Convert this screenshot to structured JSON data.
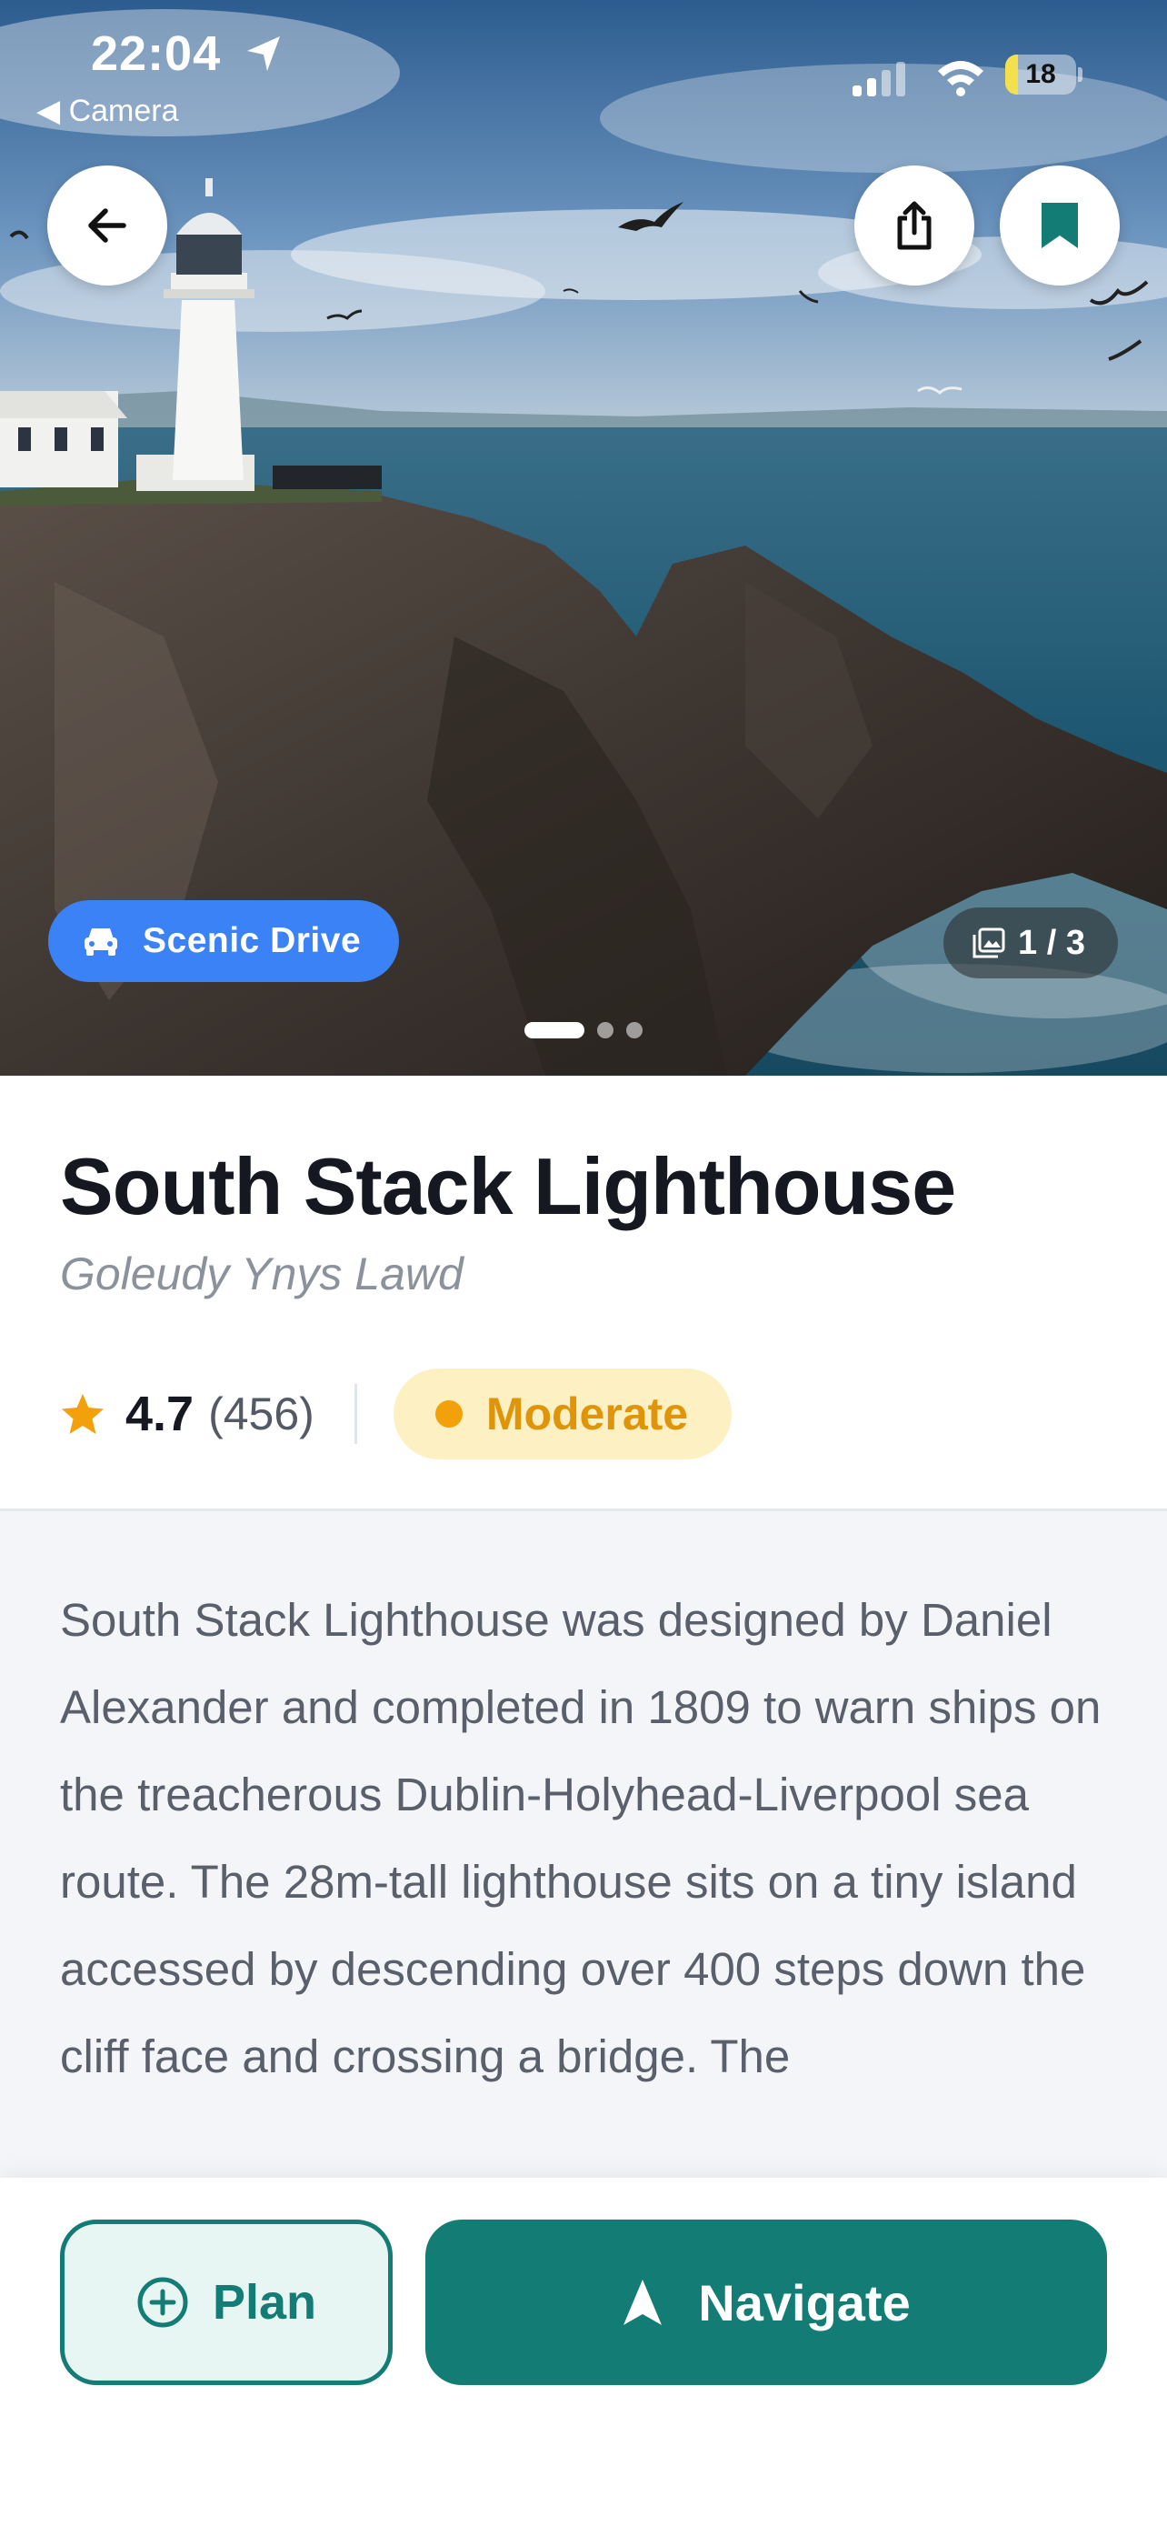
{
  "status_bar": {
    "time": "22:04",
    "back_app": "◀ Camera",
    "battery_level": "18"
  },
  "hero": {
    "category_label": "Scenic Drive",
    "photo_counter": "1 / 3",
    "pages_total": 3,
    "page_active": 1
  },
  "place": {
    "name": "South Stack Lighthouse",
    "local_name": "Goleudy Ynys Lawd",
    "rating": "4.7",
    "review_count": "(456)",
    "difficulty": "Moderate",
    "description": "South Stack Lighthouse was designed by Daniel Alexander and completed in 1809 to warn ships on the treacherous Dublin-Holyhead-Liverpool sea route. The 28m-tall lighthouse sits on a tiny island accessed by descending over 400 steps down the cliff face and crossing a bridge. The"
  },
  "actions": {
    "plan_label": "Plan",
    "navigate_label": "Navigate"
  },
  "colors": {
    "accent_teal": "#137c74",
    "scenic_blue": "#3b82f6",
    "difficulty_amber": "#e0940a",
    "star": "#f2a10b"
  },
  "icons": {
    "back": "arrow-left-icon",
    "share": "share-icon",
    "bookmark": "bookmark-icon",
    "category": "car-icon",
    "gallery": "image-icon",
    "rating": "star-icon",
    "plan": "plus-circle-icon",
    "navigate": "navigation-arrow-icon"
  }
}
